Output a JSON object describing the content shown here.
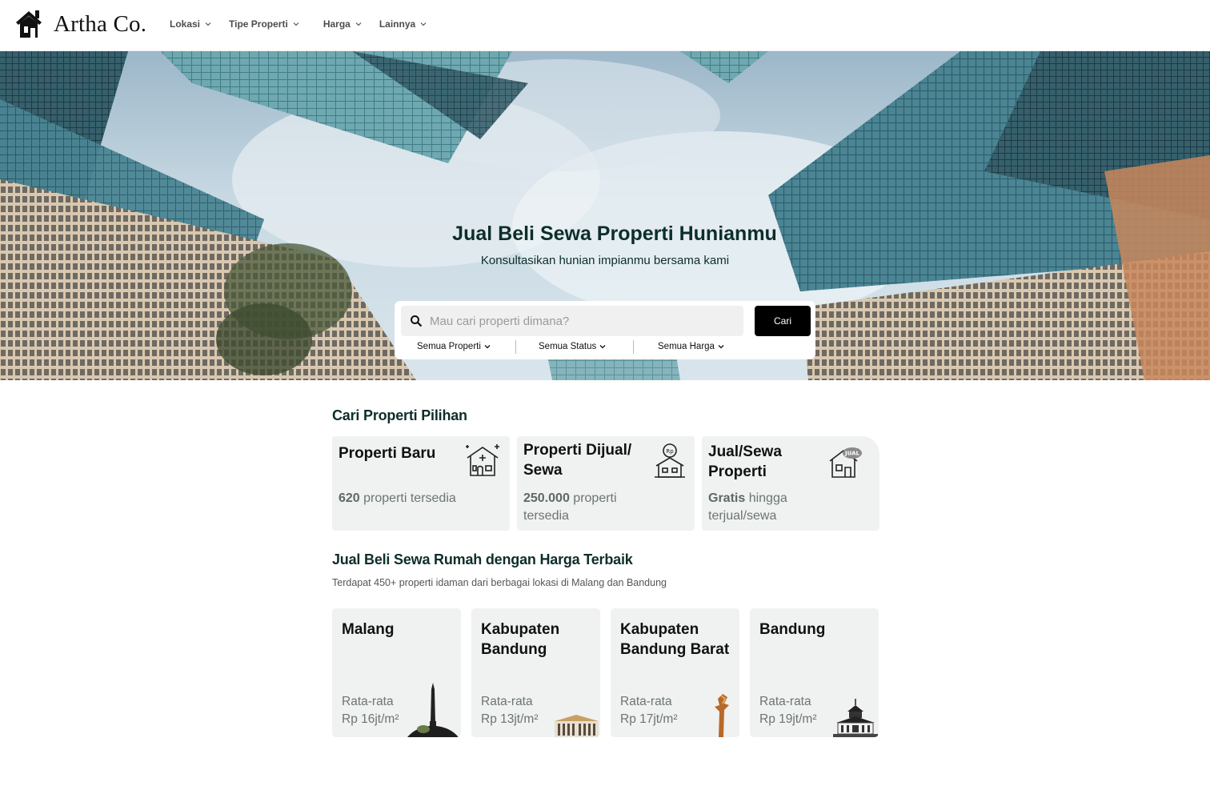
{
  "nav": {
    "brand_name": "Artha Co.",
    "menu": [
      {
        "label": "Lokasi"
      },
      {
        "label": "Tipe Properti"
      },
      {
        "label": "Harga"
      },
      {
        "label": "Lainnya"
      }
    ]
  },
  "hero": {
    "title": "Jual Beli Sewa Properti Hunianmu",
    "subtitle": "Konsultasikan hunian impianmu bersama kami"
  },
  "search": {
    "placeholder": "Mau cari properti dimana?",
    "button_label": "Cari",
    "filters": [
      {
        "label": "Semua Properti"
      },
      {
        "label": "Semua Status"
      },
      {
        "label": "Semua Harga"
      }
    ]
  },
  "featured": {
    "title": "Cari Properti Pilihan",
    "cards": [
      {
        "title": "Properti Baru",
        "highlight": "620",
        "sub": " properti tersedia",
        "icon": "sparkle-house-icon"
      },
      {
        "title": "Properti Dijual/ Sewa",
        "highlight": "250.000",
        "sub": " properti tersedia",
        "icon": "rupiah-house-icon"
      },
      {
        "title": "Jual/Sewa Properti",
        "highlight": "Gratis",
        "sub": " hingga terjual/sewa",
        "icon": "jual-sign-house-icon"
      }
    ]
  },
  "cities_section": {
    "title": "Jual Beli Sewa Rumah dengan Harga Terbaik",
    "description": "Terdapat 450+ properti idaman dari berbagai lokasi di Malang dan Bandung",
    "cities": [
      {
        "name": "Malang",
        "avg_label": "Rata-rata",
        "price": "Rp 16jt/m²",
        "icon": "monument-icon"
      },
      {
        "name": "Kabupaten Bandung",
        "avg_label": "Rata-rata",
        "price": "Rp 13jt/m²",
        "icon": "colonial-building-icon"
      },
      {
        "name": "Kabupaten Bandung Barat",
        "avg_label": "Rata-rata",
        "price": "Rp 17jt/m²",
        "icon": "statue-icon"
      },
      {
        "name": "Bandung",
        "avg_label": "Rata-rata",
        "price": "Rp 19jt/m²",
        "icon": "gedung-sate-icon"
      }
    ]
  },
  "colors": {
    "heading": "#0d2e2a",
    "card_bg": "#f0f1f1",
    "button_bg": "#000000",
    "muted_text": "#6b7474"
  }
}
